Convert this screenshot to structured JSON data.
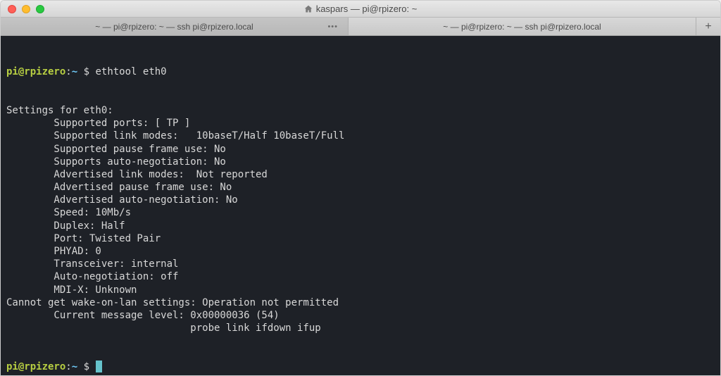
{
  "window": {
    "title": "kaspars — pi@rpizero: ~"
  },
  "tabs": [
    {
      "label": "~ — pi@rpizero: ~ — ssh pi@rpizero.local"
    },
    {
      "label": "~ — pi@rpizero: ~ — ssh pi@rpizero.local"
    }
  ],
  "prompt": {
    "user_host": "pi@rpizero",
    "sep": ":",
    "path": "~",
    "dollar": " $ "
  },
  "command": "ethtool eth0",
  "output_lines": [
    "Settings for eth0:",
    "        Supported ports: [ TP ]",
    "        Supported link modes:   10baseT/Half 10baseT/Full",
    "        Supported pause frame use: No",
    "        Supports auto-negotiation: No",
    "        Advertised link modes:  Not reported",
    "        Advertised pause frame use: No",
    "        Advertised auto-negotiation: No",
    "        Speed: 10Mb/s",
    "        Duplex: Half",
    "        Port: Twisted Pair",
    "        PHYAD: 0",
    "        Transceiver: internal",
    "        Auto-negotiation: off",
    "        MDI-X: Unknown",
    "Cannot get wake-on-lan settings: Operation not permitted",
    "        Current message level: 0x00000036 (54)",
    "                               probe link ifdown ifup"
  ]
}
